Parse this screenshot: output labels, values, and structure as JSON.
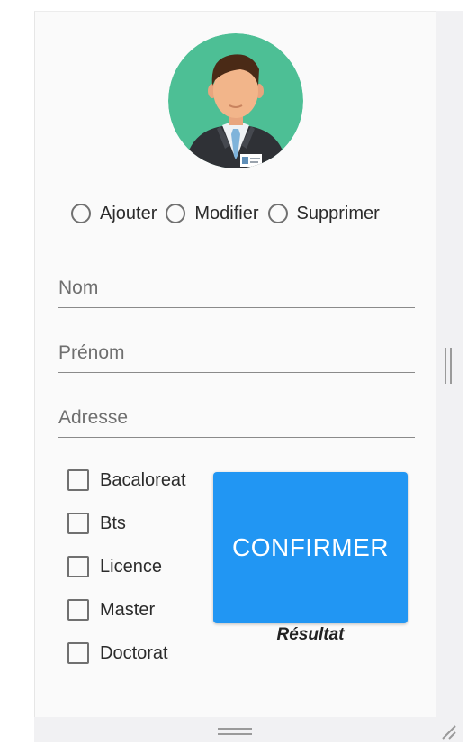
{
  "radios": [
    {
      "label": "Ajouter"
    },
    {
      "label": "Modifier"
    },
    {
      "label": "Supprimer"
    }
  ],
  "fields": {
    "nom": {
      "placeholder": "Nom",
      "value": ""
    },
    "prenom": {
      "placeholder": "Prénom",
      "value": ""
    },
    "adresse": {
      "placeholder": "Adresse",
      "value": ""
    }
  },
  "diplomas": [
    {
      "label": "Bacaloreat",
      "checked": false
    },
    {
      "label": "Bts",
      "checked": false
    },
    {
      "label": "Licence",
      "checked": false
    },
    {
      "label": "Master",
      "checked": false
    },
    {
      "label": "Doctorat",
      "checked": false
    }
  ],
  "confirm_label": "CONFIRMER",
  "result_label": "Résultat",
  "colors": {
    "accent": "#2196f3",
    "avatar_bg": "#4dbf95"
  },
  "icons": {
    "avatar": "businessman-avatar-icon",
    "splitter": "splitter-handle-icon",
    "resize": "resize-grip-icon"
  }
}
